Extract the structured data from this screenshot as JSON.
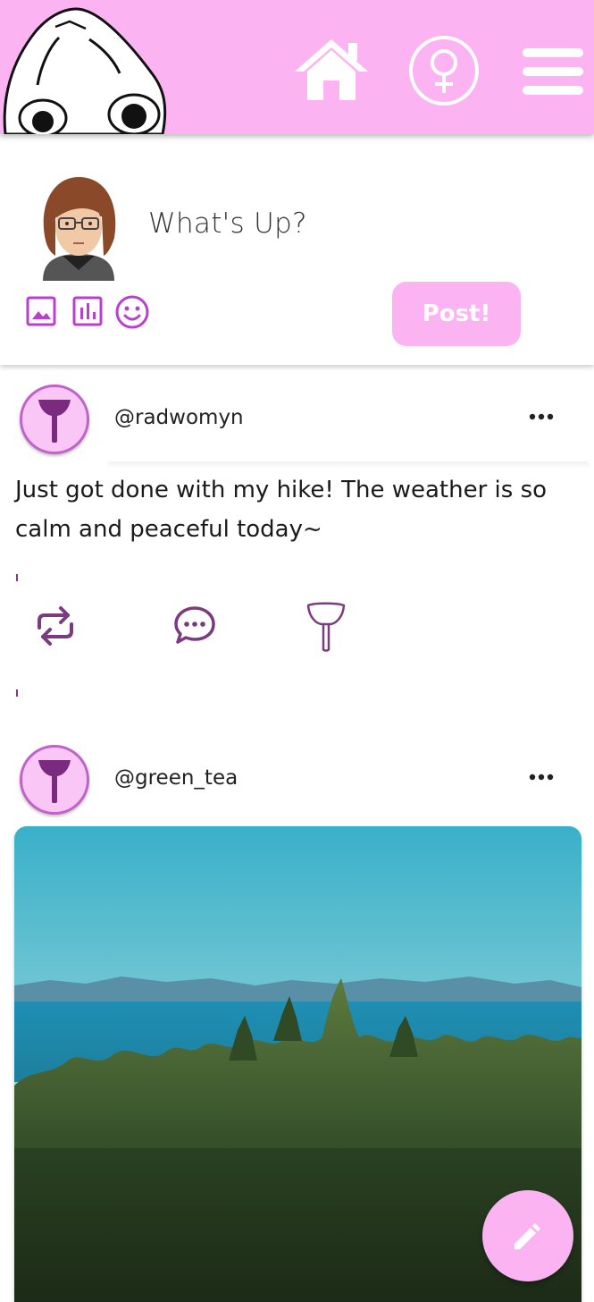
{
  "header": {
    "mascot": "ghost-mascot-logo",
    "nav_icons": [
      "home-icon",
      "venus-icon",
      "menu-icon"
    ],
    "accent_color": "#fbb4f1"
  },
  "compose": {
    "prompt": "What's Up?",
    "tools": [
      "image-icon",
      "poll-icon",
      "emoji-icon"
    ],
    "post_label": "Post!"
  },
  "posts": [
    {
      "username": "@radwomyn",
      "text": "Just got done with my hike! The weather is so calm and peaceful today~",
      "actions": [
        "repost-icon",
        "reply-icon",
        "axe-like-icon"
      ]
    },
    {
      "username": "@green_tea",
      "image": "forest-and-sea-landscape-photo"
    }
  ],
  "fab": {
    "icon": "pencil-icon",
    "color": "#fbb4f1"
  },
  "icon_color": "#b93fd0",
  "action_color": "#7a3b7f"
}
